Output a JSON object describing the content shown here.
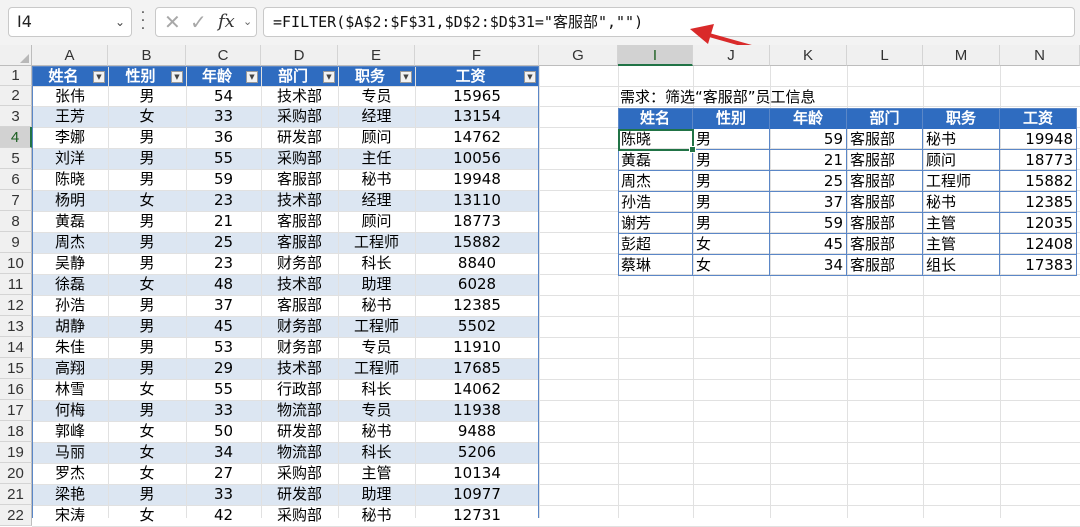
{
  "formula_bar": {
    "name_box": "I4",
    "cancel_glyph": "✕",
    "enter_glyph": "✓",
    "fx_label": "fx",
    "formula": "=FILTER($A$2:$F$31,$D$2:$D$31=\"客服部\",\"\")"
  },
  "columns": [
    "A",
    "B",
    "C",
    "D",
    "E",
    "F",
    "G",
    "I",
    "J",
    "K",
    "L",
    "M",
    "N"
  ],
  "rows": [
    "1",
    "2",
    "3",
    "4",
    "5",
    "6",
    "7",
    "8",
    "9",
    "10",
    "11",
    "12",
    "13",
    "14",
    "15",
    "16",
    "17",
    "18",
    "19",
    "20",
    "21",
    "22"
  ],
  "selected_cell": {
    "column": "I",
    "row": "4"
  },
  "source_table": {
    "headers": [
      "姓名",
      "性别",
      "年龄",
      "部门",
      "职务",
      "工资"
    ],
    "rows": [
      [
        "张伟",
        "男",
        "54",
        "技术部",
        "专员",
        "15965"
      ],
      [
        "王芳",
        "女",
        "33",
        "采购部",
        "经理",
        "13154"
      ],
      [
        "李娜",
        "男",
        "36",
        "研发部",
        "顾问",
        "14762"
      ],
      [
        "刘洋",
        "男",
        "55",
        "采购部",
        "主任",
        "10056"
      ],
      [
        "陈晓",
        "男",
        "59",
        "客服部",
        "秘书",
        "19948"
      ],
      [
        "杨明",
        "女",
        "23",
        "技术部",
        "经理",
        "13110"
      ],
      [
        "黄磊",
        "男",
        "21",
        "客服部",
        "顾问",
        "18773"
      ],
      [
        "周杰",
        "男",
        "25",
        "客服部",
        "工程师",
        "15882"
      ],
      [
        "吴静",
        "男",
        "23",
        "财务部",
        "科长",
        "8840"
      ],
      [
        "徐磊",
        "女",
        "48",
        "技术部",
        "助理",
        "6028"
      ],
      [
        "孙浩",
        "男",
        "37",
        "客服部",
        "秘书",
        "12385"
      ],
      [
        "胡静",
        "男",
        "45",
        "财务部",
        "工程师",
        "5502"
      ],
      [
        "朱佳",
        "男",
        "53",
        "财务部",
        "专员",
        "11910"
      ],
      [
        "高翔",
        "男",
        "29",
        "技术部",
        "工程师",
        "17685"
      ],
      [
        "林雪",
        "女",
        "55",
        "行政部",
        "科长",
        "14062"
      ],
      [
        "何梅",
        "男",
        "33",
        "物流部",
        "专员",
        "11938"
      ],
      [
        "郭峰",
        "女",
        "50",
        "研发部",
        "秘书",
        "9488"
      ],
      [
        "马丽",
        "女",
        "34",
        "物流部",
        "科长",
        "5206"
      ],
      [
        "罗杰",
        "女",
        "27",
        "采购部",
        "主管",
        "10134"
      ],
      [
        "梁艳",
        "男",
        "33",
        "研发部",
        "助理",
        "10977"
      ],
      [
        "宋涛",
        "女",
        "42",
        "采购部",
        "秘书",
        "12731"
      ]
    ]
  },
  "requirement_note": "需求：筛选“客服部”员工信息",
  "result_table": {
    "headers": [
      "姓名",
      "性别",
      "年龄",
      "部门",
      "职务",
      "工资"
    ],
    "rows": [
      [
        "陈晓",
        "男",
        "59",
        "客服部",
        "秘书",
        "19948"
      ],
      [
        "黄磊",
        "男",
        "21",
        "客服部",
        "顾问",
        "18773"
      ],
      [
        "周杰",
        "男",
        "25",
        "客服部",
        "工程师",
        "15882"
      ],
      [
        "孙浩",
        "男",
        "37",
        "客服部",
        "秘书",
        "12385"
      ],
      [
        "谢芳",
        "男",
        "59",
        "客服部",
        "主管",
        "12035"
      ],
      [
        "彭超",
        "女",
        "45",
        "客服部",
        "主管",
        "12408"
      ],
      [
        "蔡琳",
        "女",
        "34",
        "客服部",
        "组长",
        "17383"
      ]
    ]
  },
  "colors": {
    "header_fill": "#2f6cc0",
    "band_fill": "#dce6f2",
    "selection": "#217346",
    "arrow": "#d92a2a"
  },
  "icons": {
    "filter_button": "dropdown-arrow-icon",
    "arrow": "red-arrow-icon"
  }
}
